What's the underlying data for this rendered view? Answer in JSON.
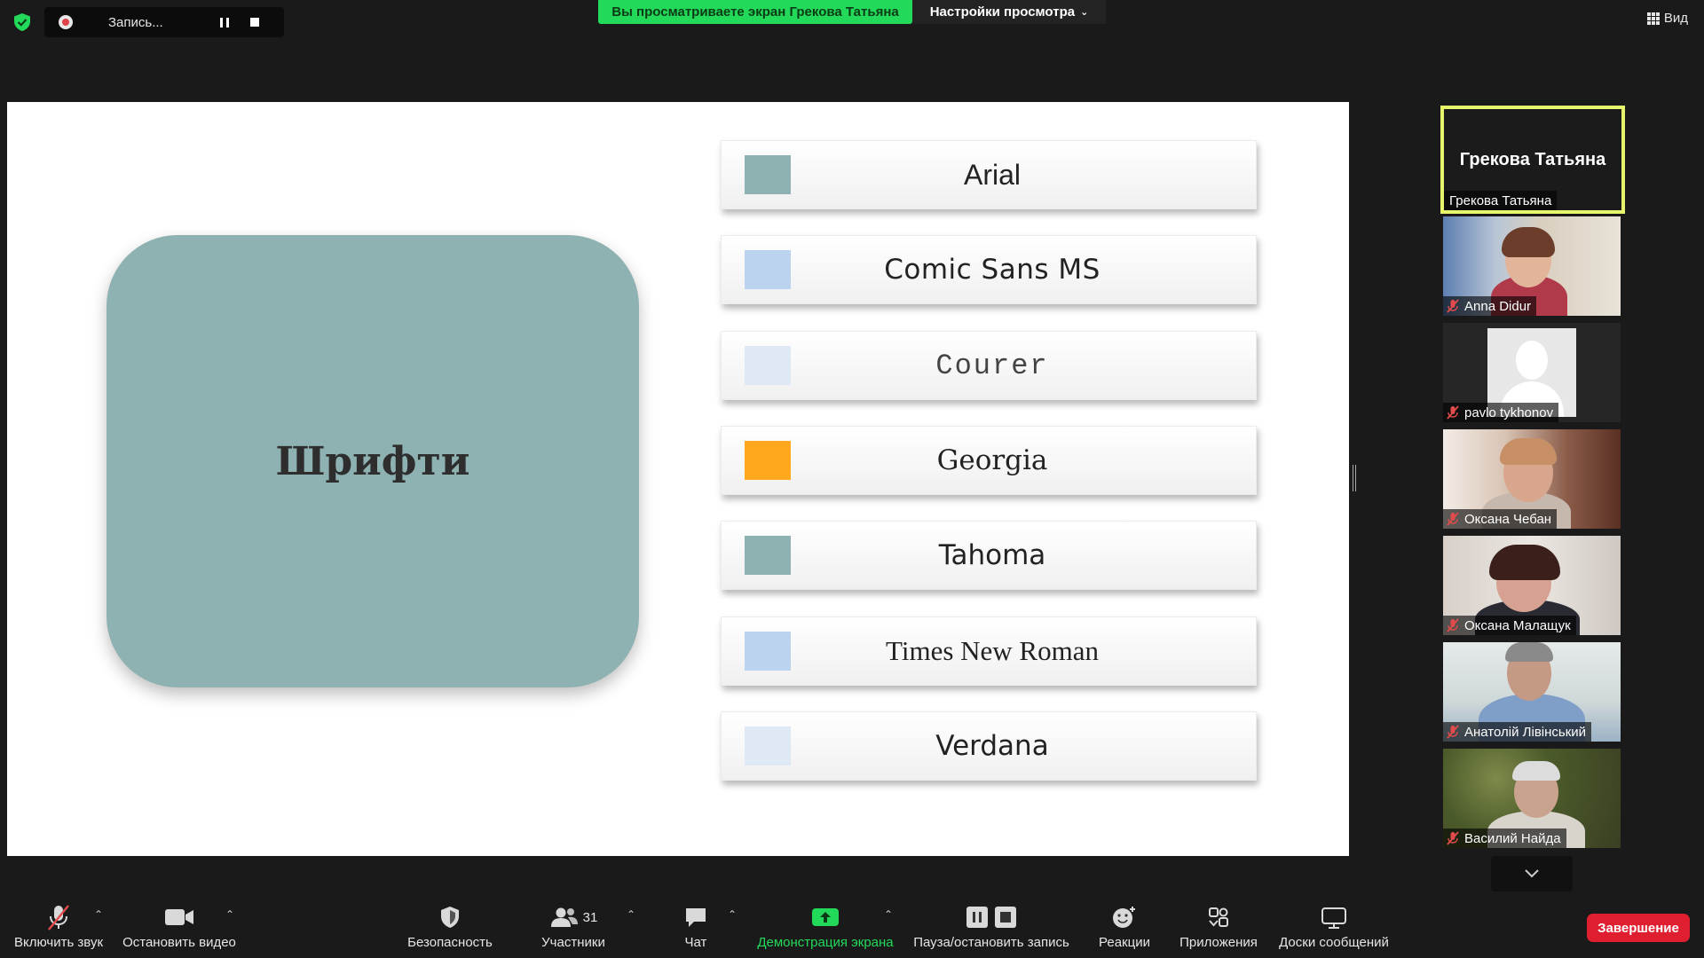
{
  "recording": {
    "label": "Запись..."
  },
  "share_banner": "Вы просматриваете экран Грекова Татьяна",
  "view_options": "Настройки просмотра",
  "view_button": "Вид",
  "slide": {
    "title": "Шрифти",
    "fonts": [
      {
        "name": "Arial",
        "swatch": "#8eb1b2"
      },
      {
        "name": "Comic Sans MS",
        "swatch": "#bcd3ef"
      },
      {
        "name": "Courer",
        "swatch": "#dfe9f6"
      },
      {
        "name": "Georgia",
        "swatch": "#ffa81e"
      },
      {
        "name": "Tahoma",
        "swatch": "#8eb1b2"
      },
      {
        "name": "Times New Roman",
        "swatch": "#bcd3ef"
      },
      {
        "name": "Verdana",
        "swatch": "#dfe9f6"
      }
    ]
  },
  "participants": {
    "active_speaker": {
      "big_name": "Грекова Татьяна",
      "label": "Грекова Татьяна"
    },
    "tiles": [
      {
        "name": "Anna Didur",
        "muted": true
      },
      {
        "name": "pavlo tykhonov",
        "muted": true
      },
      {
        "name": "Оксана Чебан",
        "muted": true
      },
      {
        "name": "Оксана Малащук",
        "muted": true
      },
      {
        "name": "Анатолій Лівінський",
        "muted": true
      },
      {
        "name": "Василий Найда",
        "muted": true
      }
    ]
  },
  "toolbar": {
    "unmute": "Включить звук",
    "stop_video": "Остановить видео",
    "security": "Безопасность",
    "participants": "Участники",
    "participants_count": "31",
    "chat": "Чат",
    "share_screen": "Демонстрация экрана",
    "pause_record": "Пауза/остановить запись",
    "reactions": "Реакции",
    "apps": "Приложения",
    "whiteboards": "Доски сообщений",
    "end": "Завершение"
  },
  "colors": {
    "accent_green": "#23d959",
    "end_red": "#df1f2f",
    "active_border": "#e6f56a"
  }
}
